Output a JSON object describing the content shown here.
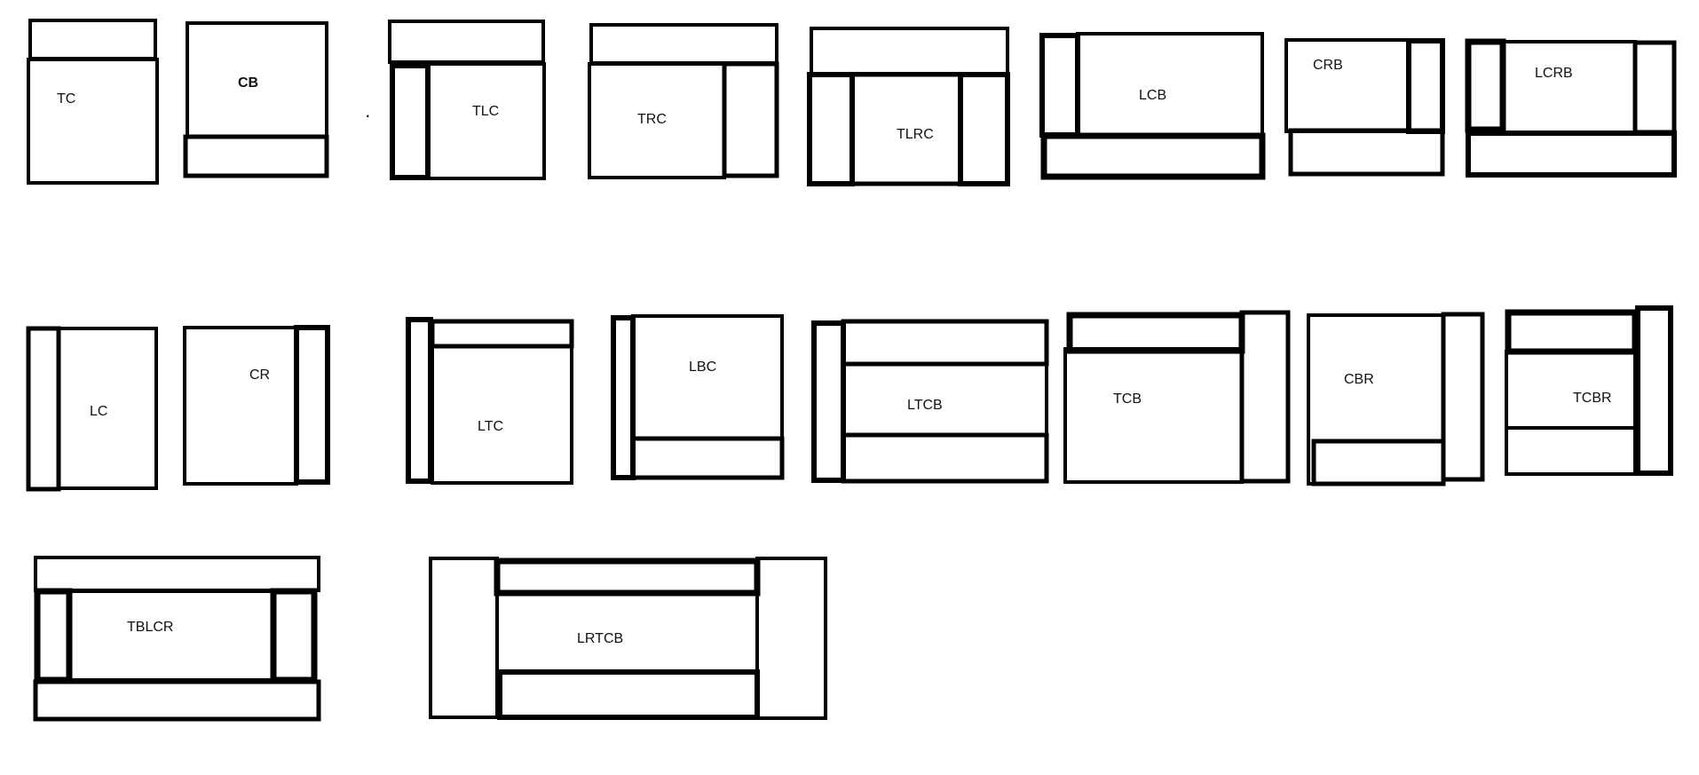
{
  "diagram": {
    "stroke_color": "#000000",
    "background": "#ffffff",
    "stray_mark": "·",
    "layouts": [
      {
        "id": "tc",
        "label": "TC"
      },
      {
        "id": "cb",
        "label": "CB"
      },
      {
        "id": "tlc",
        "label": "TLC"
      },
      {
        "id": "trc",
        "label": "TRC"
      },
      {
        "id": "tlrc",
        "label": "TLRC"
      },
      {
        "id": "lcb",
        "label": "LCB"
      },
      {
        "id": "crb",
        "label": "CRB"
      },
      {
        "id": "lcrb",
        "label": "LCRB"
      },
      {
        "id": "lc",
        "label": "LC"
      },
      {
        "id": "cr",
        "label": "CR"
      },
      {
        "id": "ltc",
        "label": "LTC"
      },
      {
        "id": "lbc",
        "label": "LBC"
      },
      {
        "id": "ltcb",
        "label": "LTCB"
      },
      {
        "id": "tcb",
        "label": "TCB"
      },
      {
        "id": "cbr",
        "label": "CBR"
      },
      {
        "id": "tcbr",
        "label": "TCBR"
      },
      {
        "id": "tblcr",
        "label": "TBLCR"
      },
      {
        "id": "lrtcb",
        "label": "LRTCB"
      }
    ]
  }
}
